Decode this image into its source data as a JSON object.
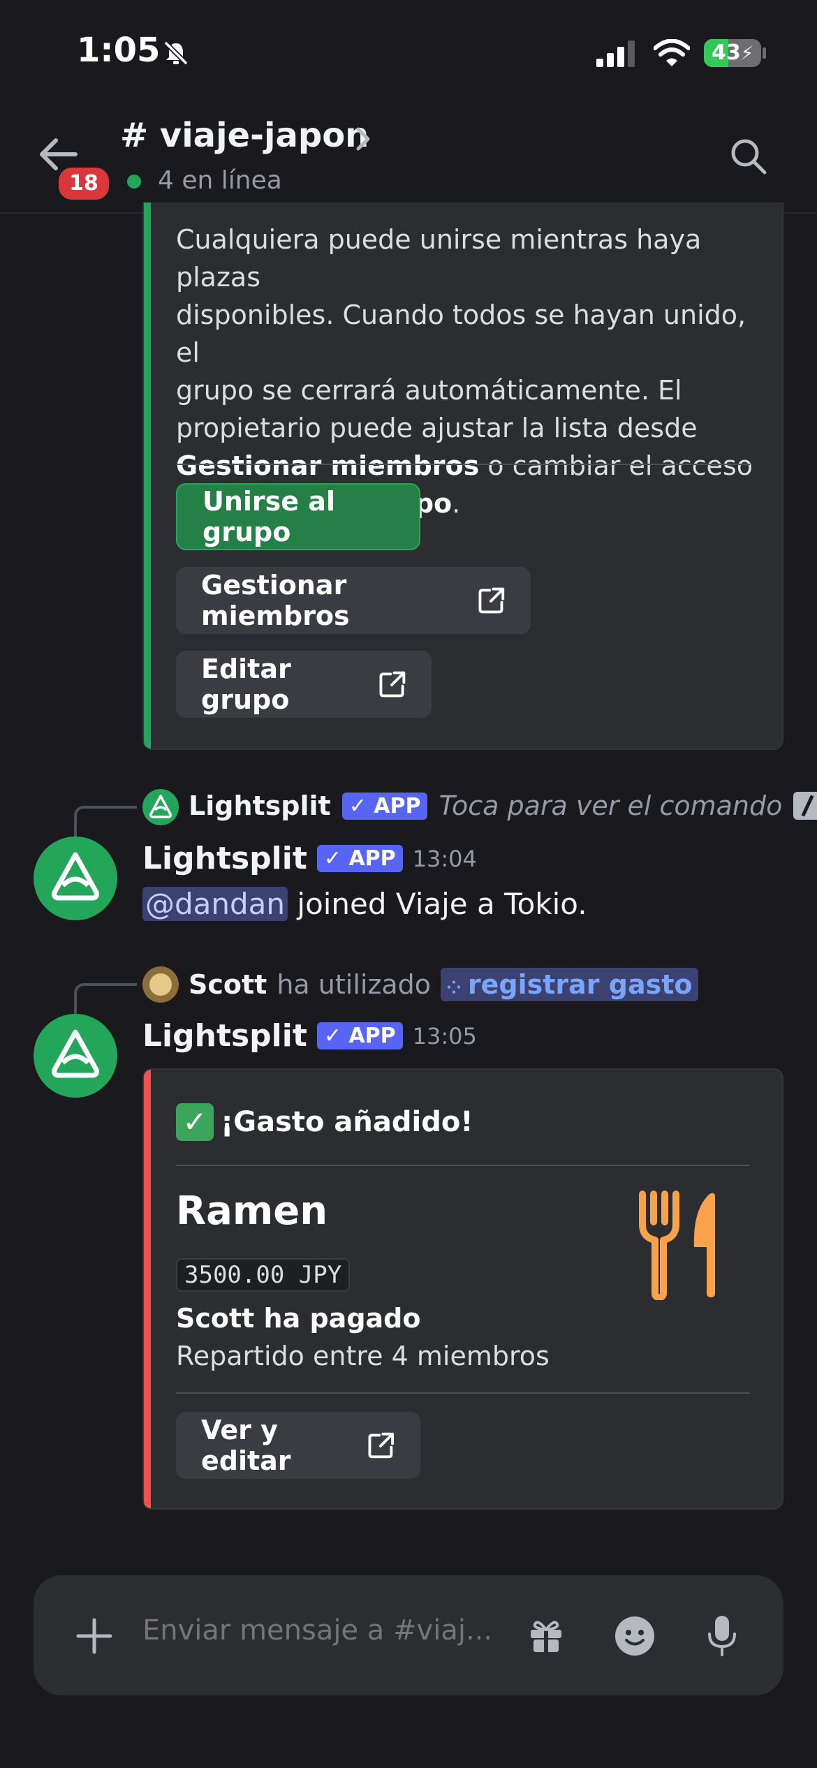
{
  "status_bar": {
    "time": "1:05",
    "battery": "43",
    "battery_level": 0.43
  },
  "header": {
    "channel_name": "# viaje-japon",
    "unread_badge": "18",
    "online_status": "4 en línea"
  },
  "group_embed": {
    "accent_color": "#23a55a",
    "text_line_1": "Cualquiera puede unirse mientras haya plazas",
    "text_line_2": "disponibles. Cuando todos se hayan unido, el",
    "text_line_3": "grupo se cerrará automáticamente. El",
    "text_line_4": "propietario puede ajustar la lista desde",
    "text_line_5_bold": "Gestionar miembros",
    "text_line_5_rest": " o cambiar el acceso",
    "text_line_6_start": "desde ",
    "text_line_6_bold": "Editar grupo",
    "text_line_6_end": ".",
    "join_button": "Unirse al grupo",
    "manage_button": "Gestionar miembros",
    "edit_button": "Editar grupo"
  },
  "message_1": {
    "reply_author": "Lightsplit",
    "reply_app_tag": "✓ APP",
    "reply_hint": "Toca para ver el comando",
    "author": "Lightsplit",
    "app_tag": "✓ APP",
    "time": "13:04",
    "mention": "@dandan",
    "text": " joined Viaje a Tokio."
  },
  "message_2": {
    "reply_author": "Scott",
    "reply_used": "ha utilizado",
    "command": "registrar gasto",
    "author": "Lightsplit",
    "app_tag": "✓ APP",
    "time": "13:05"
  },
  "expense_embed": {
    "accent_color": "#f0524d",
    "check_emoji": "✅",
    "title": "¡Gasto añadido!",
    "item": "Ramen",
    "amount": "3500.00 JPY",
    "payer": "Scott ha pagado",
    "split": "Repartido entre 4 miembros",
    "view_edit_button": "Ver y editar",
    "thumbnail_icon": "fork-and-knife-icon"
  },
  "composer": {
    "placeholder": "Enviar mensaje a #viaj..."
  }
}
